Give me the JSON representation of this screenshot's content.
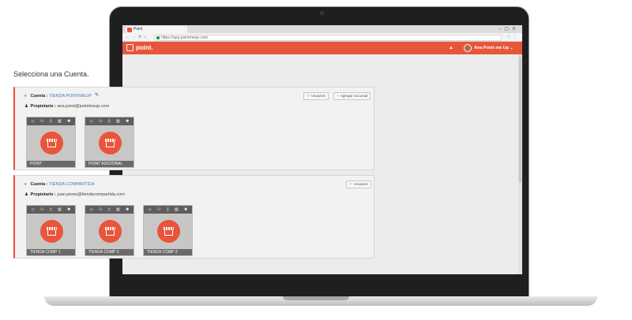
{
  "browser": {
    "tab_title": "Point",
    "url": "https://app.pointmeup.com"
  },
  "app": {
    "logo_text": "point.",
    "user_name": "Ana Point me Up",
    "accent_color": "#e8553a"
  },
  "page": {
    "title": "Selecciona una Cuenta."
  },
  "accounts": [
    {
      "account_label": "Cuenta :",
      "account_name": "TIENDA POINTMEUP",
      "owner_label": "Propietario :",
      "owner_email": "ana.point@pointmeup.com",
      "buttons": {
        "users": "Usuarios",
        "add_branch": "Agregar Sucursal"
      },
      "stores": [
        "POINT",
        "POINT ADICIONAL"
      ]
    },
    {
      "account_label": "Cuenta :",
      "account_name": "TIENDA COMPARTIDA",
      "owner_label": "Propietario :",
      "owner_email": "juan.perez@tiendacompartida.com",
      "buttons": {
        "users": "Usuarios"
      },
      "stores": [
        "TIENDA COMP 1",
        "TIENDA COMP 2",
        "TIENDA COMP 3"
      ]
    }
  ],
  "icons": {
    "store_toolbar": [
      "tag-icon",
      "users-icon",
      "document-icon",
      "barcode-icon",
      "gear-icon"
    ],
    "store": "storefront-icon"
  }
}
